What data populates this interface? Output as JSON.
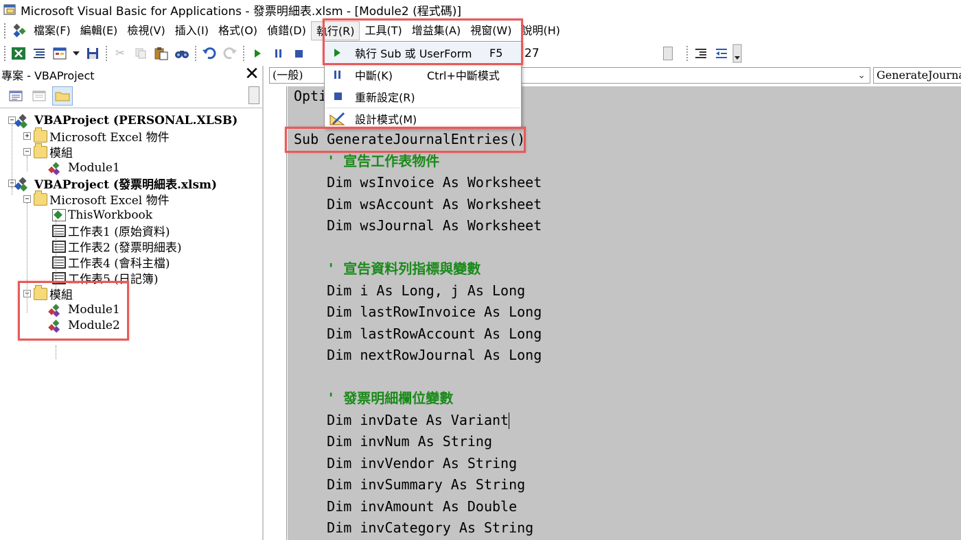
{
  "window": {
    "title": "Microsoft Visual Basic for Applications - 發票明細表.xlsm - [Module2 (程式碼)]"
  },
  "menubar": {
    "items": [
      {
        "label": "檔案(F)"
      },
      {
        "label": "編輯(E)"
      },
      {
        "label": "檢視(V)"
      },
      {
        "label": "插入(I)"
      },
      {
        "label": "格式(O)"
      },
      {
        "label": "偵錯(D)"
      },
      {
        "label": "執行(R)",
        "active": true
      },
      {
        "label": "工具(T)"
      },
      {
        "label": "增益集(A)"
      },
      {
        "label": "視窗(W)"
      },
      {
        "label": "說明(H)"
      }
    ]
  },
  "toolbar": {
    "location_text": "27",
    "icons": [
      "excel-icon",
      "insert-module-icon",
      "userform-icon",
      "dropdown-arrow-icon",
      "save-icon",
      "cut-icon",
      "copy-icon",
      "paste-icon",
      "find-icon",
      "undo-icon",
      "redo-icon",
      "run-icon",
      "break-icon",
      "reset-icon"
    ]
  },
  "run_menu": {
    "items": [
      {
        "label": "執行 Sub 或 UserForm",
        "shortcut": "F5",
        "icon": "run-icon"
      },
      {
        "label": "中斷(K)",
        "shortcut": "Ctrl+中斷模式",
        "icon": "break-icon"
      },
      {
        "label": "重新設定(R)",
        "shortcut": "",
        "icon": "reset-icon"
      },
      {
        "label": "設計模式(M)",
        "shortcut": "",
        "icon": "design-mode-icon"
      }
    ]
  },
  "project_panel": {
    "title": "專案 - VBAProject",
    "close": "✕",
    "tree": [
      {
        "label": "VBAProject (PERSONAL.XLSB)",
        "icon": "project-icon",
        "level": 0,
        "expander": "−",
        "bold": true
      },
      {
        "label": "Microsoft Excel 物件",
        "icon": "folder-icon",
        "level": 1,
        "expander": "+"
      },
      {
        "label": "模組",
        "icon": "folder-icon",
        "level": 1,
        "expander": "−"
      },
      {
        "label": "Module1",
        "icon": "module-icon",
        "level": 2,
        "expander": ""
      },
      {
        "label": "VBAProject (發票明細表.xlsm)",
        "icon": "project-icon",
        "level": 0,
        "expander": "−",
        "bold": true
      },
      {
        "label": "Microsoft Excel 物件",
        "icon": "folder-icon",
        "level": 1,
        "expander": "−"
      },
      {
        "label": "ThisWorkbook",
        "icon": "workbook-icon",
        "level": 2,
        "expander": ""
      },
      {
        "label": "工作表1 (原始資料)",
        "icon": "sheet-icon",
        "level": 2,
        "expander": ""
      },
      {
        "label": "工作表2 (發票明細表)",
        "icon": "sheet-icon",
        "level": 2,
        "expander": ""
      },
      {
        "label": "工作表4 (會科主檔)",
        "icon": "sheet-icon",
        "level": 2,
        "expander": ""
      },
      {
        "label": "工作表5 (日記簿)",
        "icon": "sheet-icon",
        "level": 2,
        "expander": ""
      },
      {
        "label": "模組",
        "icon": "folder-icon",
        "level": 1,
        "expander": "−"
      },
      {
        "label": "Module1",
        "icon": "module-icon",
        "level": 2,
        "expander": ""
      },
      {
        "label": "Module2",
        "icon": "module-icon",
        "level": 2,
        "expander": ""
      }
    ]
  },
  "code_window": {
    "object_combo": "(一般)",
    "procedure_combo": "GenerateJournalEntries",
    "lines": [
      {
        "text": "Opti",
        "type": "code"
      },
      {
        "text": "",
        "type": "code"
      },
      {
        "text": "Sub GenerateJournalEntries()",
        "type": "code"
      },
      {
        "text": "    ' 宣告工作表物件",
        "type": "comment"
      },
      {
        "text": "    Dim wsInvoice As Worksheet",
        "type": "code"
      },
      {
        "text": "    Dim wsAccount As Worksheet",
        "type": "code"
      },
      {
        "text": "    Dim wsJournal As Worksheet",
        "type": "code"
      },
      {
        "text": "",
        "type": "code"
      },
      {
        "text": "    ' 宣告資料列指標與變數",
        "type": "comment"
      },
      {
        "text": "    Dim i As Long, j As Long",
        "type": "code"
      },
      {
        "text": "    Dim lastRowInvoice As Long",
        "type": "code"
      },
      {
        "text": "    Dim lastRowAccount As Long",
        "type": "code"
      },
      {
        "text": "    Dim nextRowJournal As Long",
        "type": "code"
      },
      {
        "text": "",
        "type": "code"
      },
      {
        "text": "    ' 發票明細欄位變數",
        "type": "comment"
      },
      {
        "text": "    Dim invDate As Variant",
        "type": "code"
      },
      {
        "text": "    Dim invNum As String",
        "type": "code"
      },
      {
        "text": "    Dim invVendor As String",
        "type": "code"
      },
      {
        "text": "    Dim invSummary As String",
        "type": "code"
      },
      {
        "text": "    Dim invAmount As Double",
        "type": "code"
      },
      {
        "text": "    Dim invCategory As String",
        "type": "code"
      }
    ]
  },
  "colors": {
    "highlight_box": "#e85a5a",
    "comment": "#1a8a1a",
    "code_bg": "#c4c4c4"
  }
}
